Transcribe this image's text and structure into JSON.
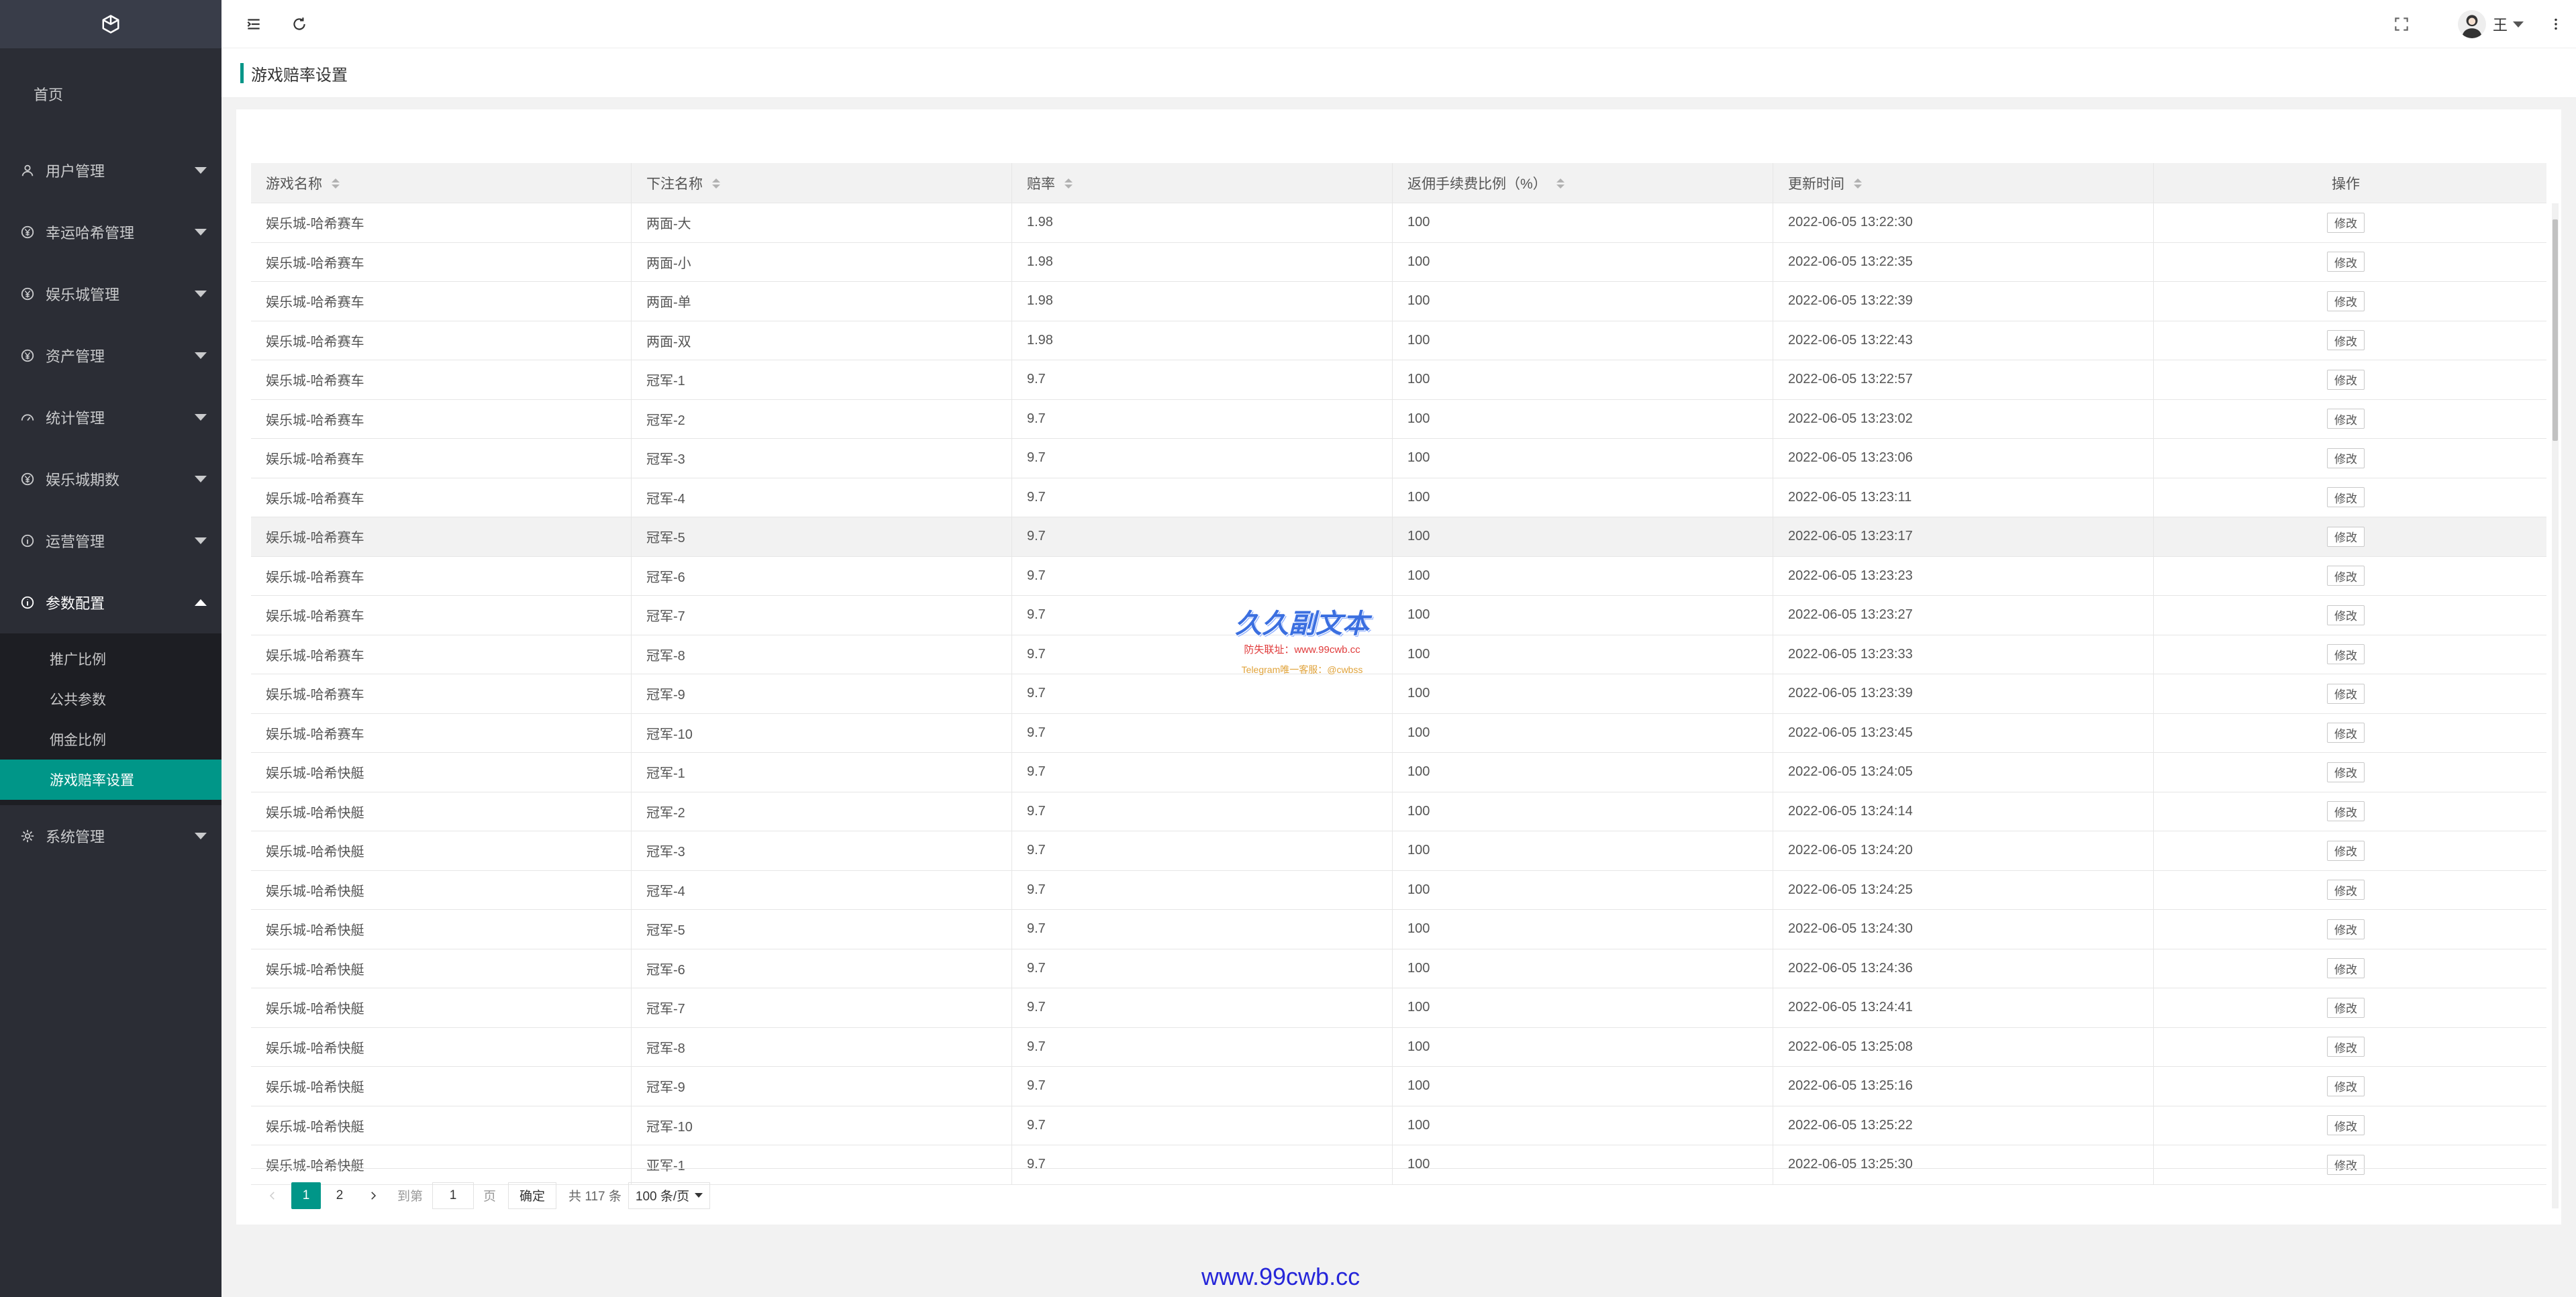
{
  "sidebar": {
    "home": "首页",
    "items": [
      {
        "label": "用户管理",
        "icon": "user-icon"
      },
      {
        "label": "幸运哈希管理",
        "icon": "yen-icon"
      },
      {
        "label": "娱乐城管理",
        "icon": "yen-icon"
      },
      {
        "label": "资产管理",
        "icon": "yen-icon"
      },
      {
        "label": "统计管理",
        "icon": "dashboard-icon"
      },
      {
        "label": "娱乐城期数",
        "icon": "yen-icon"
      },
      {
        "label": "运营管理",
        "icon": "info-icon"
      },
      {
        "label": "参数配置",
        "icon": "info-icon"
      }
    ],
    "sub_items": [
      "推广比例",
      "公共参数",
      "佣金比例",
      "游戏赔率设置"
    ],
    "system": {
      "label": "系统管理",
      "icon": "gear-icon"
    }
  },
  "header": {
    "username": "王"
  },
  "page_title": "游戏赔率设置",
  "table": {
    "columns": [
      "游戏名称",
      "下注名称",
      "赔率",
      "返佣手续费比例（%）",
      "更新时间",
      "操作"
    ],
    "action_label": "修改",
    "rows": [
      [
        "娱乐城-哈希赛车",
        "两面-大",
        "1.98",
        "100",
        "2022-06-05 13:22:30"
      ],
      [
        "娱乐城-哈希赛车",
        "两面-小",
        "1.98",
        "100",
        "2022-06-05 13:22:35"
      ],
      [
        "娱乐城-哈希赛车",
        "两面-单",
        "1.98",
        "100",
        "2022-06-05 13:22:39"
      ],
      [
        "娱乐城-哈希赛车",
        "两面-双",
        "1.98",
        "100",
        "2022-06-05 13:22:43"
      ],
      [
        "娱乐城-哈希赛车",
        "冠军-1",
        "9.7",
        "100",
        "2022-06-05 13:22:57"
      ],
      [
        "娱乐城-哈希赛车",
        "冠军-2",
        "9.7",
        "100",
        "2022-06-05 13:23:02"
      ],
      [
        "娱乐城-哈希赛车",
        "冠军-3",
        "9.7",
        "100",
        "2022-06-05 13:23:06"
      ],
      [
        "娱乐城-哈希赛车",
        "冠军-4",
        "9.7",
        "100",
        "2022-06-05 13:23:11"
      ],
      [
        "娱乐城-哈希赛车",
        "冠军-5",
        "9.7",
        "100",
        "2022-06-05 13:23:17"
      ],
      [
        "娱乐城-哈希赛车",
        "冠军-6",
        "9.7",
        "100",
        "2022-06-05 13:23:23"
      ],
      [
        "娱乐城-哈希赛车",
        "冠军-7",
        "9.7",
        "100",
        "2022-06-05 13:23:27"
      ],
      [
        "娱乐城-哈希赛车",
        "冠军-8",
        "9.7",
        "100",
        "2022-06-05 13:23:33"
      ],
      [
        "娱乐城-哈希赛车",
        "冠军-9",
        "9.7",
        "100",
        "2022-06-05 13:23:39"
      ],
      [
        "娱乐城-哈希赛车",
        "冠军-10",
        "9.7",
        "100",
        "2022-06-05 13:23:45"
      ],
      [
        "娱乐城-哈希快艇",
        "冠军-1",
        "9.7",
        "100",
        "2022-06-05 13:24:05"
      ],
      [
        "娱乐城-哈希快艇",
        "冠军-2",
        "9.7",
        "100",
        "2022-06-05 13:24:14"
      ],
      [
        "娱乐城-哈希快艇",
        "冠军-3",
        "9.7",
        "100",
        "2022-06-05 13:24:20"
      ],
      [
        "娱乐城-哈希快艇",
        "冠军-4",
        "9.7",
        "100",
        "2022-06-05 13:24:25"
      ],
      [
        "娱乐城-哈希快艇",
        "冠军-5",
        "9.7",
        "100",
        "2022-06-05 13:24:30"
      ],
      [
        "娱乐城-哈希快艇",
        "冠军-6",
        "9.7",
        "100",
        "2022-06-05 13:24:36"
      ],
      [
        "娱乐城-哈希快艇",
        "冠军-7",
        "9.7",
        "100",
        "2022-06-05 13:24:41"
      ],
      [
        "娱乐城-哈希快艇",
        "冠军-8",
        "9.7",
        "100",
        "2022-06-05 13:25:08"
      ],
      [
        "娱乐城-哈希快艇",
        "冠军-9",
        "9.7",
        "100",
        "2022-06-05 13:25:16"
      ],
      [
        "娱乐城-哈希快艇",
        "冠军-10",
        "9.7",
        "100",
        "2022-06-05 13:25:22"
      ],
      [
        "娱乐城-哈希快艇",
        "亚军-1",
        "9.7",
        "100",
        "2022-06-05 13:25:30"
      ]
    ]
  },
  "pager": {
    "pages": [
      "1",
      "2"
    ],
    "goto_label": "到第",
    "goto_value": "1",
    "page_unit": "页",
    "confirm": "确定",
    "total": "共 117 条",
    "page_size": "100 条/页"
  },
  "watermark": {
    "title": "久久副文本",
    "line1": "防失联址：www.99cwb.cc",
    "line2": "Telegram唯一客服：@cwbss",
    "footer": "www.99cwb.cc"
  },
  "colors": {
    "accent": "#009688",
    "sidebar_bg": "#2b2d35",
    "submenu_bg": "#1d1e23"
  }
}
